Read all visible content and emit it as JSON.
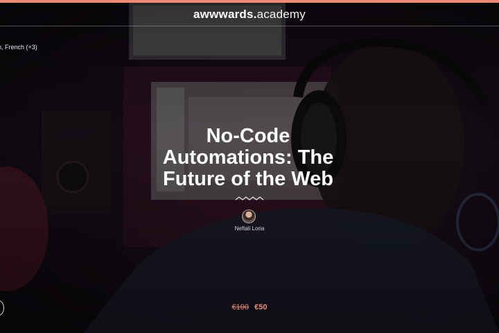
{
  "header": {
    "logo_bold": "awwwards.",
    "logo_regular": "academy"
  },
  "course": {
    "languages": "h, French (+3)",
    "title_lines": [
      "No-Code",
      "Automations: The",
      "Future of the Web"
    ],
    "instructor": "Neftali Loria",
    "price_old": "€100",
    "price_new": "€50"
  },
  "colors": {
    "accent": "#f08a76",
    "background": "#0d0a10"
  },
  "icons": [
    "squiggle-divider-icon",
    "play-icon",
    "avatar"
  ]
}
